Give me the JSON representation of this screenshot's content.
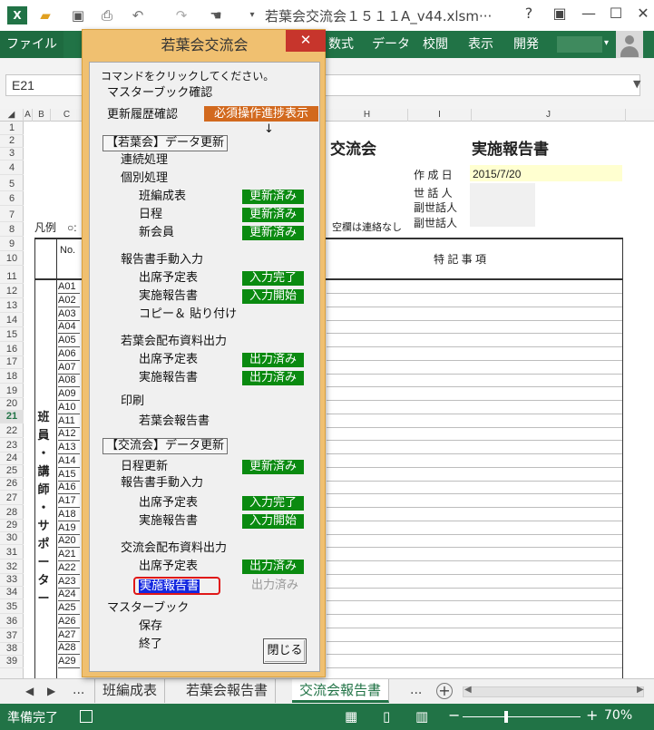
{
  "window": {
    "title": "若葉会交流会１５１１A_v44.xlsm···",
    "help": "?",
    "minimize": "—",
    "maximize": "☐",
    "close": "✕"
  },
  "ribbon": {
    "tabs": [
      "ファイル",
      "数式",
      "データ",
      "校閲",
      "表示",
      "開発"
    ]
  },
  "formula_bar": {
    "name_box": "E21"
  },
  "columns": [
    "A",
    "B",
    "C",
    "",
    "",
    "",
    "",
    "H",
    "I",
    "J"
  ],
  "rows": [
    "1",
    "2",
    "3",
    "4",
    "5",
    "6",
    "7",
    "8",
    "9",
    "10",
    "11",
    "12",
    "13",
    "14",
    "15",
    "16",
    "17",
    "18",
    "19",
    "20",
    "21",
    "22",
    "23",
    "24",
    "25",
    "26",
    "27",
    "28",
    "29",
    "30",
    "31",
    "32",
    "33",
    "34",
    "35",
    "36",
    "37",
    "38",
    "39"
  ],
  "sheet": {
    "title_part": "交流会",
    "report_title": "実施報告書",
    "date_label": "作 成 日",
    "date_value": "2015/7/20",
    "caretaker": "世 話 人",
    "vice_caretaker_1": "副世話人",
    "vice_caretaker_2": "副世話人",
    "legend": "凡例　○:",
    "blank_note": "空欄は連絡なし",
    "no_header": "No.",
    "remarks_header": "特 記 事 項",
    "vertical_label": [
      "班",
      "員",
      "・",
      "講",
      "師",
      "・",
      "サ",
      "ポ",
      "ー",
      "タ",
      "ー"
    ],
    "member_ids": [
      "A01",
      "A02",
      "A03",
      "A04",
      "A05",
      "A06",
      "A07",
      "A08",
      "A09",
      "A10",
      "A11",
      "A12",
      "A13",
      "A14",
      "A15",
      "A16",
      "A17",
      "A18",
      "A19",
      "A20",
      "A21",
      "A22",
      "A23",
      "A24",
      "A25",
      "A26",
      "A27",
      "A28",
      "A29"
    ]
  },
  "sheet_tabs": {
    "nav_prev": "◀",
    "nav_next": "▶",
    "ellipsis_left": "...",
    "tabs": [
      "班編成表",
      "若葉会報告書",
      "交流会報告書"
    ],
    "ellipsis_right": "...",
    "add": "+"
  },
  "status": {
    "text": "準備完了",
    "zoom": "70%",
    "zoom_minus": "−",
    "zoom_plus": "+"
  },
  "dialog": {
    "title": "若葉会交流会",
    "close": "✕",
    "instruction": "コマンドをクリックしてください。",
    "master_check": "マスターブック確認",
    "history_check": "更新履歴確認",
    "required_btn": "必須操作進捗表示",
    "arrow": "↓",
    "wakaba_group": "【若葉会】データ更新",
    "continuous": "連続処理",
    "individual": "個別処理",
    "group_table": "班編成表",
    "schedule": "日程",
    "new_member": "新会員",
    "badge_updated": "更新済み",
    "report_manual": "報告書手動入力",
    "attendance_plan": "出席予定表",
    "implementation_report": "実施報告書",
    "input_done": "入力完了",
    "input_started": "入力開始",
    "copy_paste": "コピー＆ 貼り付け",
    "wakaba_output": "若葉会配布資料出力",
    "output_done": "出力済み",
    "print": "印刷",
    "wakaba_report": "若葉会報告書",
    "kouryu_group": "【交流会】データ更新",
    "schedule_update": "日程更新",
    "kouryu_output": "交流会配布資料出力",
    "master_book": "マスターブック",
    "save": "保存",
    "exit": "終了",
    "close_btn": "閉じる"
  }
}
